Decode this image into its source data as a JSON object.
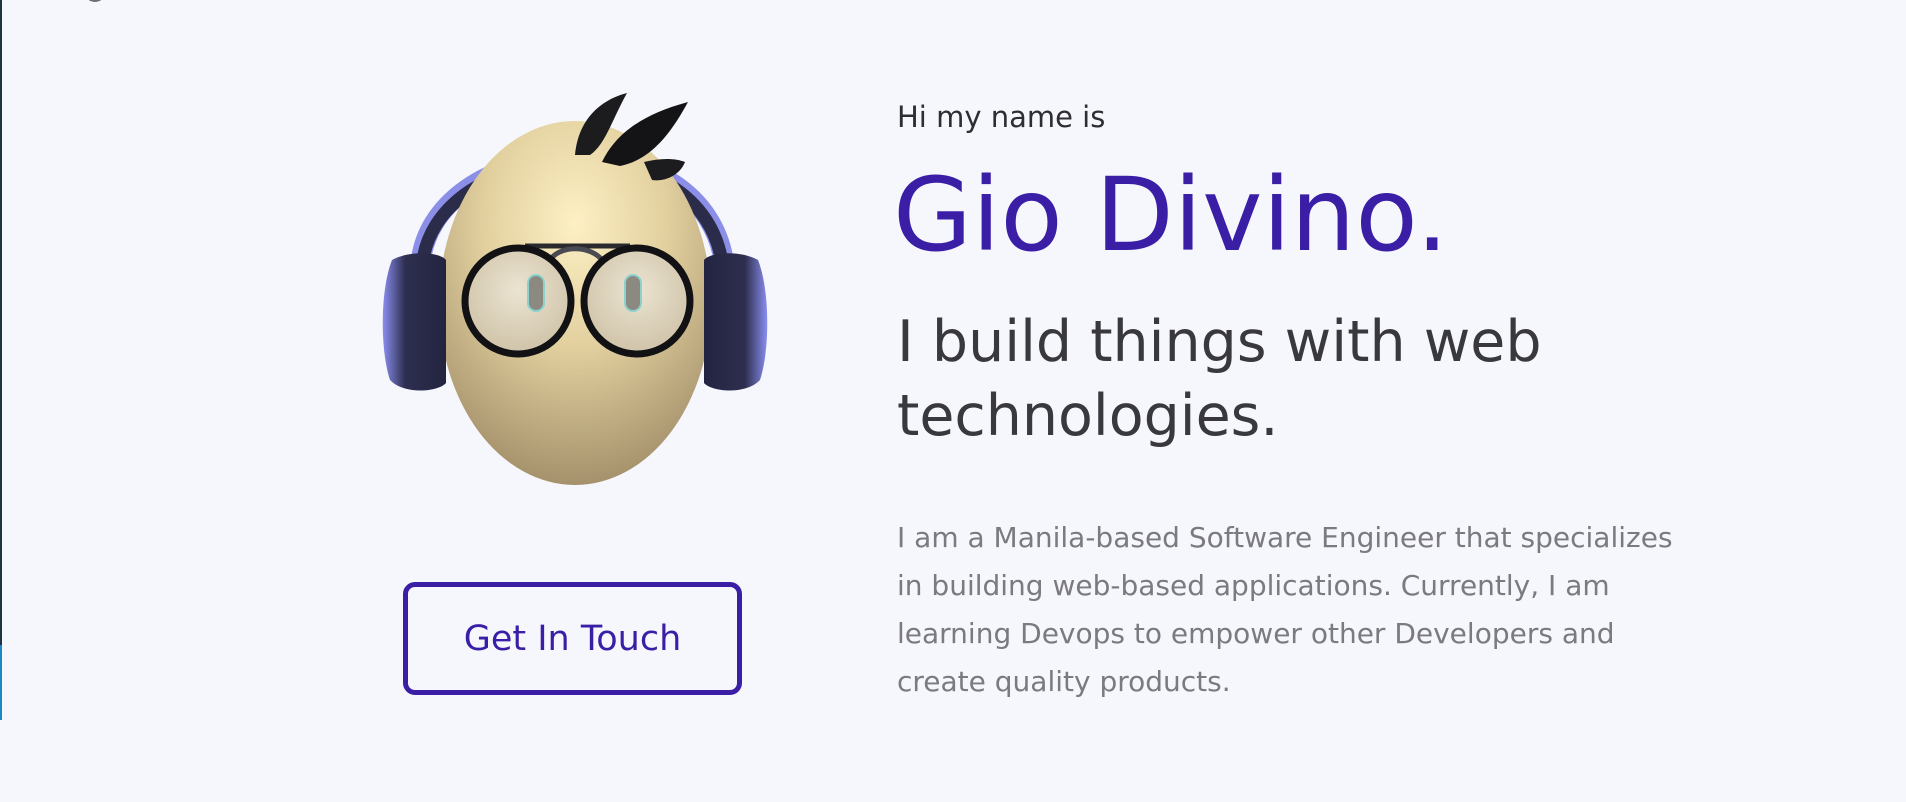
{
  "hero": {
    "intro": "Hi my name is",
    "name": "Gio Divino.",
    "tagline": "I build things with web technologies.",
    "bio": "I am a Manila-based Software Engineer that specializes in building web-based applications. Currently, I am learning Devops to empower other Developers and create quality products.",
    "cta_label": "Get In Touch"
  },
  "colors": {
    "accent": "#3a1fa6",
    "background": "#f6f7fc",
    "heading_text": "#38383d",
    "body_text": "#7a7a80"
  },
  "icons": {
    "avatar": "memoji-avatar-headphones-glasses"
  }
}
